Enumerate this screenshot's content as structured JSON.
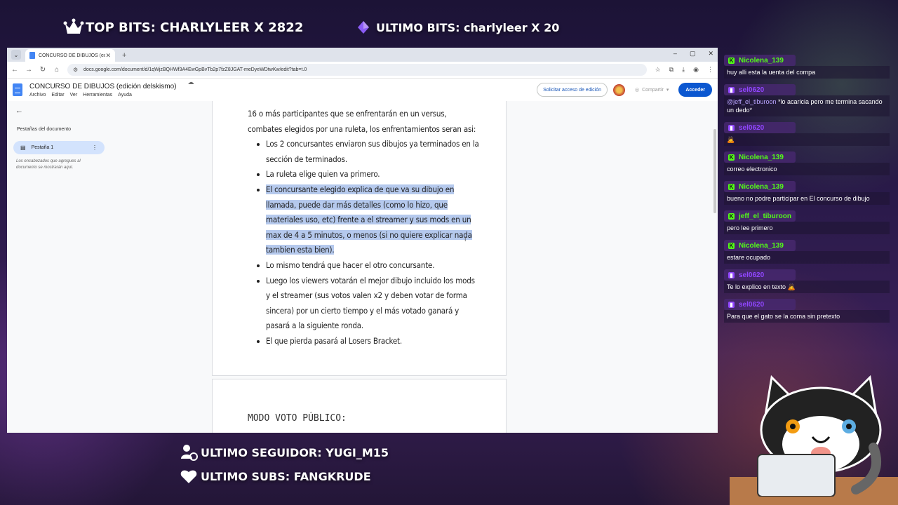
{
  "overlay": {
    "top_bits": "TOP BITS: CHARLYLEER X 2822",
    "last_bits": "ULTIMO BITS: charlyleer X 20",
    "last_follower": "ULTIMO SEGUIDOR: YUGI_M15",
    "last_subs": "ULTIMO SUBS: FANGKRUDE",
    "colors": {
      "bits_gem": "#8b5cf6",
      "kick_green": "#53fc18",
      "twitch_purple": "#9146ff"
    }
  },
  "browser": {
    "tab_title": "CONCURSO DE DIBUJOS (edic",
    "url": "docs.google.com/document/d/1qWjzBQHWf3A4EwGpBvTb2p7fzZ8JGAT-meDyeWDtwKw/edit?tab=t.0",
    "window_controls": [
      "–",
      "▢",
      "✕"
    ]
  },
  "doc": {
    "title": "CONCURSO DE DIBUJOS (edición delskismo)",
    "menu": [
      "Archivo",
      "Editar",
      "Ver",
      "Herramientas",
      "Ayuda"
    ],
    "request_edit": "Solicitar acceso de edición",
    "share": "Compartir",
    "login": "Acceder",
    "sidebar": {
      "title": "Pestañas del documento",
      "tab": "Pestaña 1",
      "hint": "Los encabezados que agregues al documento se mostrarán aquí."
    },
    "intro": "16 o más participantes que se enfrentarán en un versus, combates elegidos por una ruleta, los enfrentamientos seran asi:",
    "bullets": [
      "Los 2 concursantes enviaron sus dibujos ya terminados en la sección de terminados.",
      "La ruleta elige quien va primero.",
      "El concursante elegido explica de que va su dibujo en llamada, puede dar más detalles (como lo hizo, que materiales uso, etc) frente a el streamer y sus mods en un max de 4 a 5 minutos, o menos (si no quiere explicar nada tambien esta bien).",
      "Lo mismo tendrá que hacer el otro concursante.",
      "Luego los viewers votarán el mejor dibujo incluido los mods y el streamer (sus votos valen x2 y deben votar de forma sincera) por un cierto tiempo y el más votado ganará y pasará a la siguiente ronda.",
      "El que pierda pasará al Losers Bracket."
    ],
    "heading2": "MODO VOTO PÚBLICO:"
  },
  "chat": [
    {
      "user": "Nicolena_139",
      "platform": "kick",
      "color": "#53fc18",
      "text": "huy alli esta la uenta del compa"
    },
    {
      "user": "sel0620",
      "platform": "twitch",
      "color": "#9146ff",
      "mention": "@jeff_el_tiburoon",
      "text": " *lo acaricia pero me termina sacando un dedo*"
    },
    {
      "user": "sel0620",
      "platform": "twitch",
      "color": "#9146ff",
      "text": "🙇"
    },
    {
      "user": "Nicolena_139",
      "platform": "kick",
      "color": "#53fc18",
      "text": "correo electronico"
    },
    {
      "user": "Nicolena_139",
      "platform": "kick",
      "color": "#53fc18",
      "text": "bueno no podre participar en El concurso de dibujo"
    },
    {
      "user": "jeff_el_tiburoon",
      "platform": "kick",
      "color": "#53fc18",
      "text": "pero lee primero"
    },
    {
      "user": "Nicolena_139",
      "platform": "kick",
      "color": "#53fc18",
      "text": "estare ocupado"
    },
    {
      "user": "sel0620",
      "platform": "twitch",
      "color": "#9146ff",
      "text": "Te lo explico en texto 🙇"
    },
    {
      "user": "sel0620",
      "platform": "twitch",
      "color": "#9146ff",
      "text": "Para que el gato se la coma sin pretexto"
    }
  ]
}
